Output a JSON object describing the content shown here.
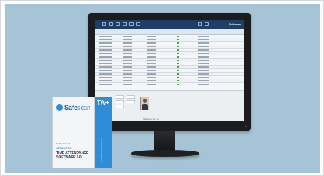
{
  "app": {
    "brand": "Safescan",
    "status_bar": "Safescan  TA+  v6"
  },
  "product_box": {
    "logo_main": "Safe",
    "logo_accent": "scan",
    "badge": "TA+",
    "side_text": "Time Attendance Software",
    "small_label": "SAFESCAN TA",
    "title_line1": "ADVANCED",
    "title_line2": "TIME ATTENDANCE SOFTWARE 6.0"
  },
  "colors": {
    "backdrop": "#a7c4d6",
    "brand_blue": "#2e8dd6",
    "app_header": "#1d3e66"
  },
  "grid": {
    "row_count": 15,
    "present_marker_color": "#3fa34d"
  }
}
